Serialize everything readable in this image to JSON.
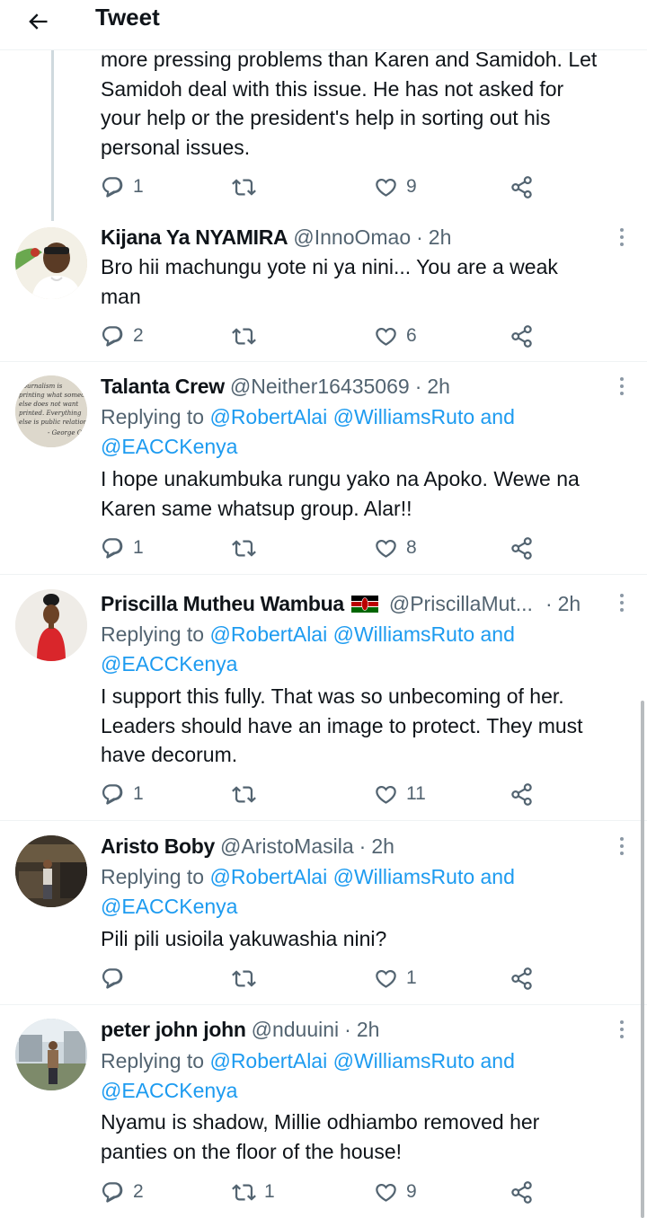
{
  "header": {
    "title": "Tweet"
  },
  "first_tweet": {
    "lines": [
      "more pressing problems than Karen and Samidoh. Let",
      "Samidoh deal with this issue. He has not asked for",
      "your help or the president's help in sorting out his",
      "personal issues."
    ],
    "replies": "1",
    "retweets": "",
    "likes": "9"
  },
  "tweets": [
    {
      "name": "Kijana Ya NYAMIRA",
      "handle": "@InnoOmao",
      "time": "2h",
      "lines": [
        "Bro hii machungu yote ni ya nini... You are a weak",
        "man"
      ],
      "replies": "2",
      "retweets": "",
      "likes": "6"
    },
    {
      "name": "Talanta Crew",
      "handle": "@Neither16435069",
      "time": "2h",
      "replying_prefix": "Replying to",
      "mention1": "@RobertAlai",
      "mention2": "@WilliamsRuto",
      "and_word": "and",
      "mention3": "@EACCKenya",
      "lines": [
        "I hope unakumbuka rungu yako na Apoko. Wewe na",
        "Karen same whatsup group. Alar!!"
      ],
      "replies": "1",
      "retweets": "",
      "likes": "8"
    },
    {
      "name": "Priscilla Mutheu Wambua",
      "flag": "🇰🇪",
      "handle": "@PriscillaMut...",
      "time": "2h",
      "replying_prefix": "Replying to",
      "mention1": "@RobertAlai",
      "mention2": "@WilliamsRuto",
      "and_word": "and",
      "mention3": "@EACCKenya",
      "lines": [
        "I support this fully. That was so unbecoming of her.",
        "Leaders should have an image to protect. They must",
        "have decorum."
      ],
      "replies": "1",
      "retweets": "",
      "likes": "11"
    },
    {
      "name": "Aristo Boby",
      "handle": "@AristoMasila",
      "time": "2h",
      "replying_prefix": "Replying to",
      "mention1": "@RobertAlai",
      "mention2": "@WilliamsRuto",
      "and_word": "and",
      "mention3": "@EACCKenya",
      "lines": [
        "Pili pili usioila yakuwashia nini?"
      ],
      "replies": "",
      "retweets": "",
      "likes": "1"
    },
    {
      "name": "peter john john",
      "handle": "@nduuini",
      "time": "2h",
      "replying_prefix": "Replying to",
      "mention1": "@RobertAlai",
      "mention2": "@WilliamsRuto",
      "and_word": "and",
      "mention3": "@EACCKenya",
      "lines": [
        "Nyamu is shadow, Millie odhiambo removed her",
        "panties on the floor of the house!"
      ],
      "replies": "2",
      "retweets": "1",
      "likes": "9"
    }
  ],
  "avatar_text": {
    "talanta": [
      "Journalism is",
      "printing what someone",
      "else does not want",
      "printed. Everything",
      "else is public relations",
      "- George Orwell"
    ]
  },
  "icons": {
    "back": "arrow-left-icon",
    "reply": "reply-icon",
    "retweet": "retweet-icon",
    "like": "heart-icon",
    "share": "share-icon",
    "more": "more-vertical-icon"
  },
  "colors": {
    "link": "#1d9bf0",
    "secondary": "#536471",
    "text": "#0f1419",
    "divider": "#eff3f4"
  }
}
